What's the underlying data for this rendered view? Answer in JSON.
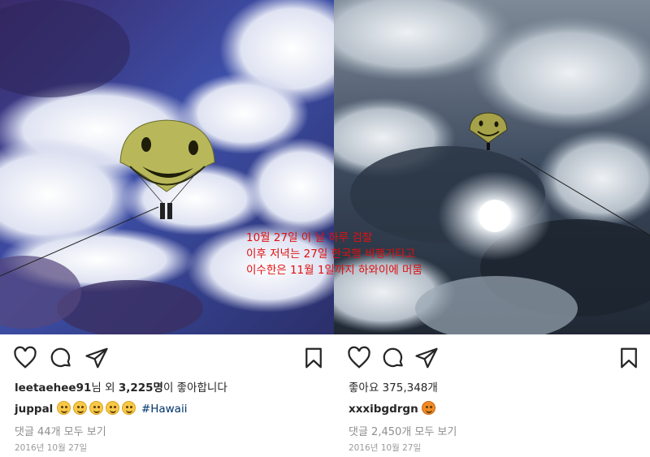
{
  "overlay": {
    "line1": "10월 27일 이 날 하루 검찰",
    "line2": "이후 저녁는 27일 한국행 비행기타고",
    "line3": "이수한은 11월 1일까지 하와이에 머뭄"
  },
  "left_post": {
    "likes_user": "leetaehee91",
    "likes_suffix": "님 외 ",
    "likes_count": "3,225명",
    "likes_tail": "이 좋아합니다",
    "caption_user": "juppal",
    "caption_emoji_count": 5,
    "caption_hashtag": "#Hawaii",
    "comments": "댓글 44개 모두 보기",
    "date": "2016년 10월 27일"
  },
  "right_post": {
    "likes": "좋아요 375,348개",
    "caption_user": "xxxibgdrgn",
    "comments": "댓글 2,450개 모두 보기",
    "date": "2016년 10월 27일"
  },
  "icons": [
    "heart-icon",
    "comment-icon",
    "share-icon",
    "bookmark-icon"
  ],
  "colors": {
    "overlay_red": "#e01010",
    "hashtag": "#003569",
    "muted": "#8e8e8e"
  }
}
